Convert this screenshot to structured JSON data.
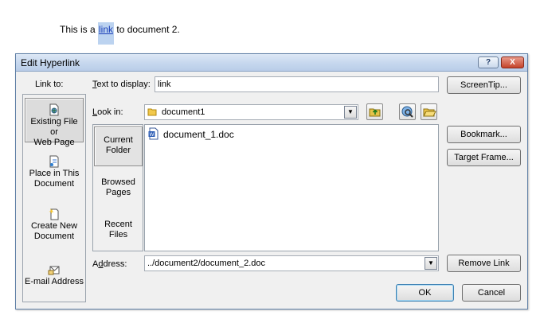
{
  "document": {
    "text_before": "This is a ",
    "link_text": "link",
    "text_after": " to document 2."
  },
  "dialog": {
    "title": "Edit Hyperlink",
    "help_button": "?",
    "close_button": "X",
    "link_to_label": "Link to:",
    "text_to_display_label": "Text to display:",
    "text_to_display_value": "link",
    "look_in_label": "Look in:",
    "look_in_value": "document1",
    "address_label": "Address:",
    "address_value": "../document2/document_2.doc",
    "places": [
      {
        "line1": "Existing File or",
        "line2": "Web Page"
      },
      {
        "line1": "Place in This",
        "line2": "Document"
      },
      {
        "line1": "Create New",
        "line2": "Document"
      },
      {
        "line1": "E-mail Address",
        "line2": ""
      }
    ],
    "side_tabs": [
      {
        "line1": "Current",
        "line2": "Folder"
      },
      {
        "line1": "Browsed",
        "line2": "Pages"
      },
      {
        "line1": "Recent",
        "line2": "Files"
      }
    ],
    "files": [
      "document_1.doc"
    ],
    "buttons": {
      "screentip": "ScreenTip...",
      "bookmark": "Bookmark...",
      "target_frame": "Target Frame...",
      "remove_link": "Remove Link",
      "ok": "OK",
      "cancel": "Cancel"
    },
    "icons": {
      "up_folder": "up-one-folder-icon",
      "browse_web": "browse-web-icon",
      "browse_file": "browse-file-icon",
      "folder": "folder-icon",
      "word_doc": "word-document-icon"
    },
    "colors": {
      "link": "#1a3fb8",
      "link_highlight": "#bcd3f0",
      "title_bar": "#c6d7ee",
      "close_red": "#c4432a",
      "dialog_bg": "#f0f0f0"
    }
  }
}
